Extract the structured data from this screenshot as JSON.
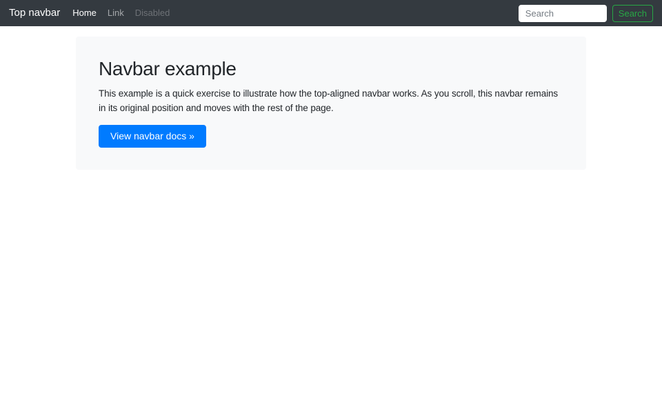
{
  "navbar": {
    "brand": "Top navbar",
    "links": [
      {
        "label": "Home",
        "state": "active"
      },
      {
        "label": "Link",
        "state": "default"
      },
      {
        "label": "Disabled",
        "state": "disabled"
      }
    ],
    "search": {
      "placeholder": "Search",
      "button_label": "Search"
    }
  },
  "hero": {
    "title": "Navbar example",
    "description": "This example is a quick exercise to illustrate how the top-aligned navbar works. As you scroll, this navbar remains in its original position and moves with the rest of the page.",
    "cta_label": "View navbar docs »"
  },
  "colors": {
    "navbar_bg": "#343a40",
    "hero_bg": "#f8f9fa",
    "primary": "#007bff",
    "success": "#28a745",
    "body_text": "#212529"
  }
}
